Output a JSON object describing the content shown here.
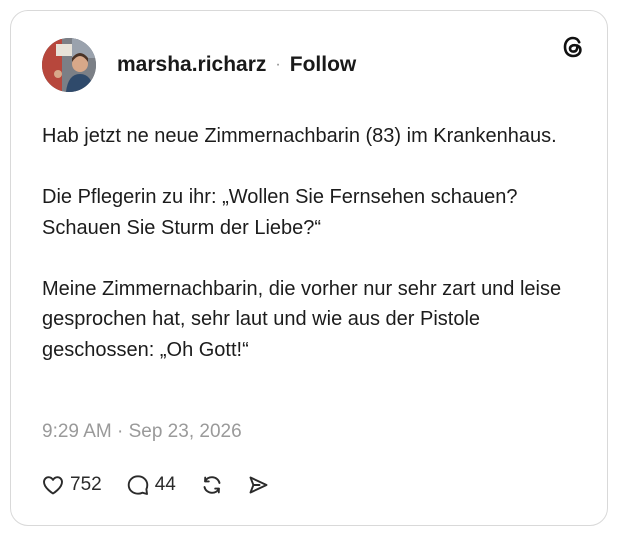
{
  "post": {
    "author": "marsha.richarz",
    "separator": "·",
    "follow_label": "Follow",
    "paragraphs": [
      "Hab jetzt ne neue Zimmernachbarin (83) im Krankenhaus.",
      "Die Pflegerin zu ihr: „Wollen Sie Fernsehen schauen? Schauen Sie Sturm der Liebe?“",
      "Meine Zimmernachbarin, die vorher nur sehr zart und leise gesprochen hat, sehr laut und wie aus der Pistole geschossen: „Oh Gott!“"
    ],
    "timestamp": "9:29 AM · Sep 23, 2026"
  },
  "actions": {
    "like_count": "752",
    "reply_count": "44"
  },
  "icons": {
    "logo": "threads-logo-icon",
    "like": "heart-icon",
    "reply": "speech-bubble-icon",
    "repost": "repost-icon",
    "share": "send-icon"
  }
}
